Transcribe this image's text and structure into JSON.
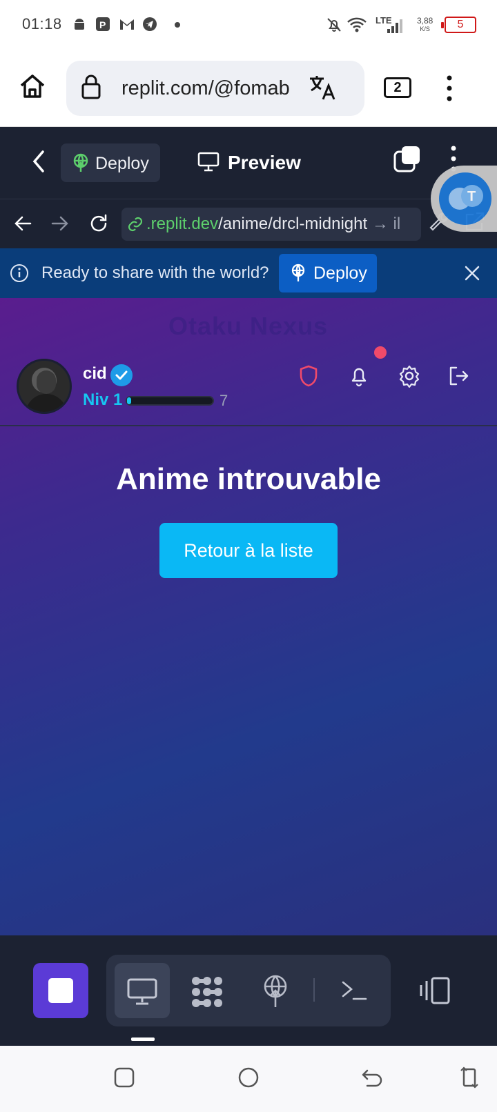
{
  "status_bar": {
    "time": "01:18",
    "network": "LTE",
    "net_speed_value": "3,88",
    "net_speed_unit": "K/S",
    "battery": "5",
    "icons": [
      "android-icon",
      "app-p-icon",
      "gmail-icon",
      "telegram-icon",
      "dot-icon",
      "mute-icon",
      "wifi-icon",
      "signal-icon"
    ]
  },
  "browser": {
    "url": "replit.com/@fomab",
    "tab_count": "2"
  },
  "replit_header": {
    "deploy_tab": "Deploy",
    "preview_tab": "Preview"
  },
  "replit_url": {
    "domain": ".replit.dev",
    "path": "/anime/drcl-midnight",
    "extra": "→ il"
  },
  "banner": {
    "message": "Ready to share with the world?",
    "deploy_button": "Deploy"
  },
  "app": {
    "brand": "Otaku Nexus",
    "user": {
      "name": "cid",
      "level": "Niv 1",
      "xp": "7",
      "xp_fraction": 0.05
    },
    "title": "Anime introuvable",
    "back_button": "Retour à la liste"
  },
  "colors": {
    "accent_cyan": "#16c7f2",
    "stop_purple": "#5b3bd6",
    "replit_bg": "#1c2232",
    "banner_bg": "#0a3d7a"
  }
}
